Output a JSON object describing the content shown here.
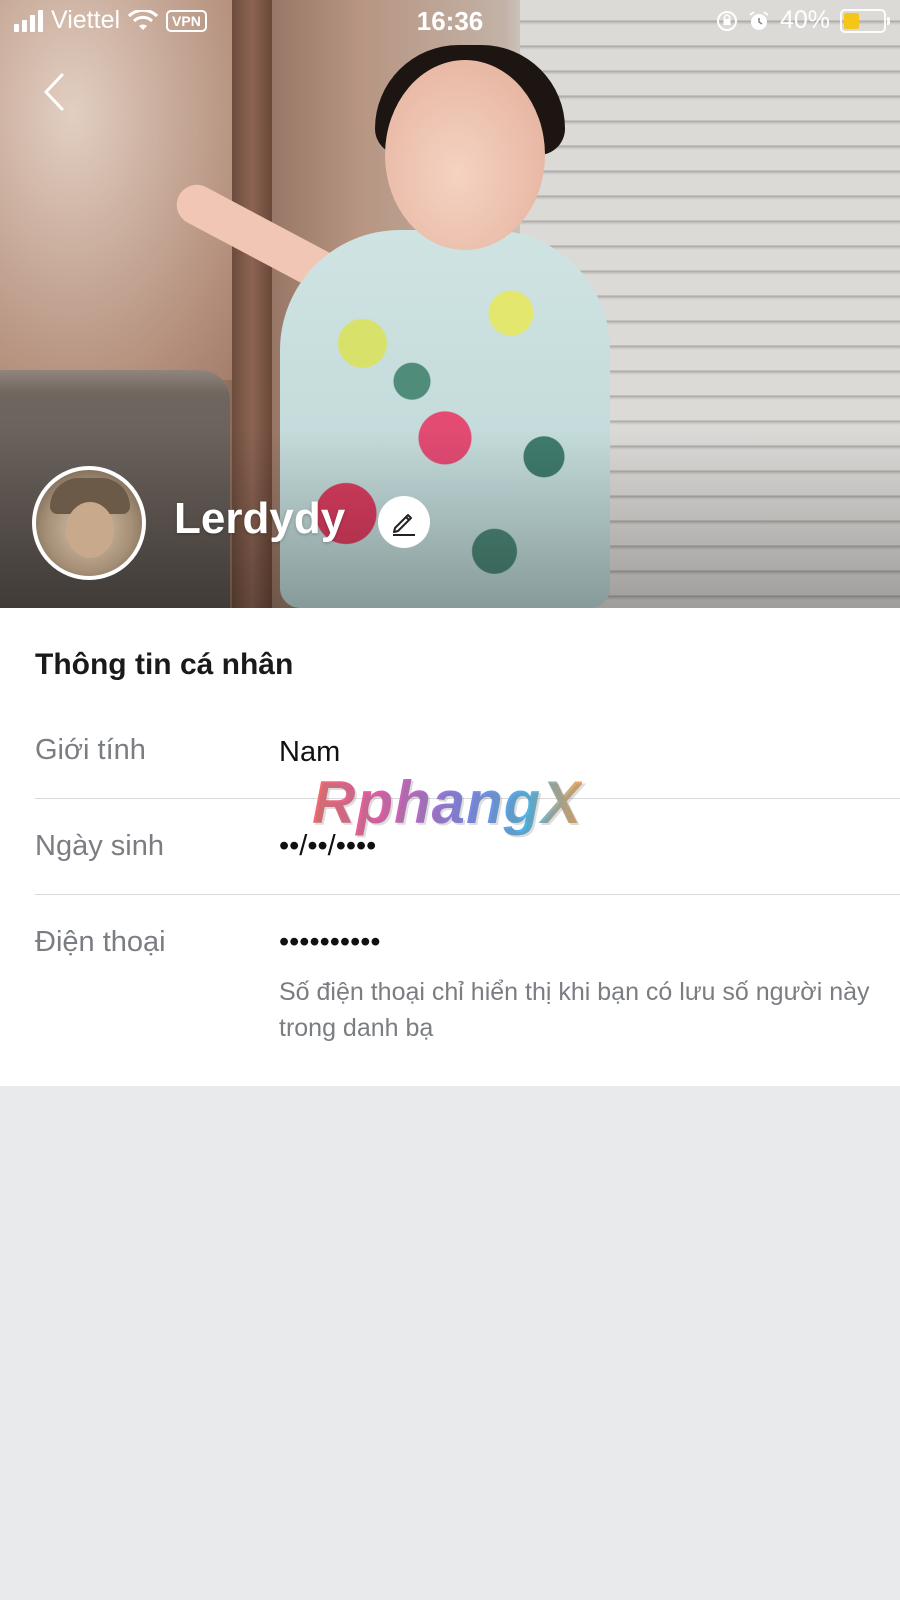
{
  "status_bar": {
    "carrier": "Viettel",
    "vpn": "VPN",
    "time": "16:36",
    "battery": "40%",
    "battery_level": 0.4
  },
  "profile": {
    "name": "Lerdydy"
  },
  "section": {
    "title": "Thông tin cá nhân"
  },
  "info": {
    "gender_label": "Giới tính",
    "gender_value": "Nam",
    "birthday_label": "Ngày sinh",
    "birthday_value": "••/••/••••",
    "phone_label": "Điện thoại",
    "phone_value": "••••••••••",
    "phone_hint": "Số điện thoại chỉ hiển thị khi bạn có lưu số người này trong danh bạ"
  },
  "watermark": "RphangX",
  "colors": {
    "battery_fill": "#f5c518",
    "label_gray": "#7a7d82",
    "page_bg": "#e9eaec"
  }
}
